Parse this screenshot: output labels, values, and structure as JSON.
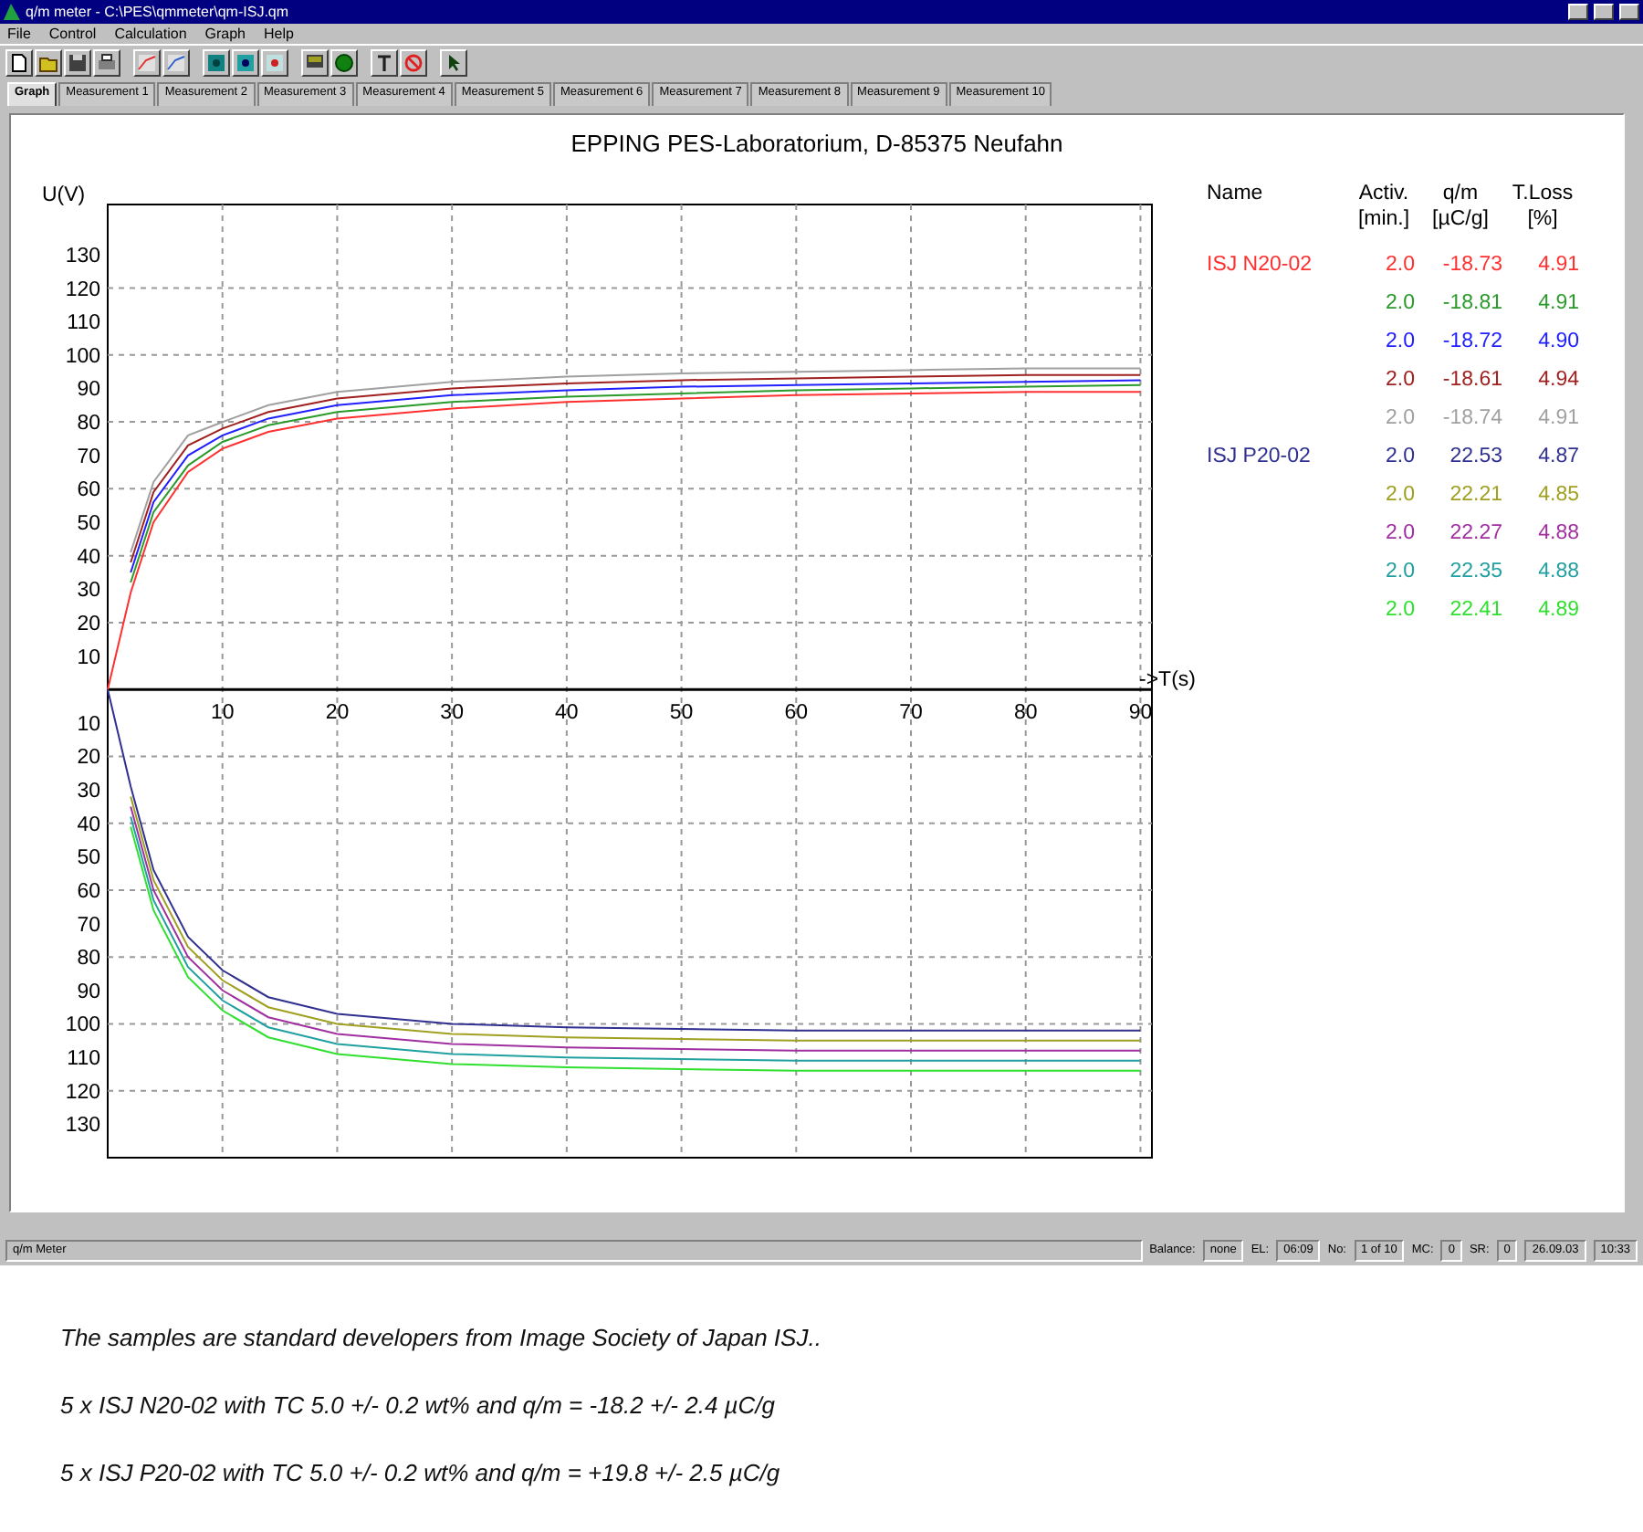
{
  "window": {
    "title": "q/m meter - C:\\PES\\qmmeter\\qm-ISJ.qm"
  },
  "menu": [
    "File",
    "Control",
    "Calculation",
    "Graph",
    "Help"
  ],
  "tabs": [
    {
      "label": "Graph",
      "selected": true
    },
    {
      "label": "Measurement 1",
      "selected": false
    },
    {
      "label": "Measurement 2",
      "selected": false
    },
    {
      "label": "Measurement 3",
      "selected": false
    },
    {
      "label": "Measurement 4",
      "selected": false
    },
    {
      "label": "Measurement 5",
      "selected": false
    },
    {
      "label": "Measurement 6",
      "selected": false
    },
    {
      "label": "Measurement 7",
      "selected": false
    },
    {
      "label": "Measurement 8",
      "selected": false
    },
    {
      "label": "Measurement 9",
      "selected": false
    },
    {
      "label": "Measurement 10",
      "selected": false
    }
  ],
  "graph": {
    "title": "EPPING PES-Laboratorium, D-85375 Neufahn",
    "chart_data": {
      "type": "line",
      "grid": true,
      "ylabel": "U(V)",
      "xlabel": "->T(s)",
      "x": [
        0,
        2,
        4,
        7,
        10,
        14,
        20,
        30,
        40,
        50,
        60,
        70,
        80,
        90
      ],
      "xlim": [
        0,
        91
      ],
      "ylim": [
        -140,
        145
      ],
      "xticks": [
        10,
        20,
        30,
        40,
        50,
        60,
        70,
        80,
        90
      ],
      "yticks": [
        {
          "value": -130,
          "label": "130"
        },
        {
          "value": -120,
          "label": "120"
        },
        {
          "value": -110,
          "label": "110"
        },
        {
          "value": -100,
          "label": "100"
        },
        {
          "value": -90,
          "label": "90"
        },
        {
          "value": -80,
          "label": "80"
        },
        {
          "value": -70,
          "label": "70"
        },
        {
          "value": -60,
          "label": "60"
        },
        {
          "value": -50,
          "label": "50"
        },
        {
          "value": -40,
          "label": "40"
        },
        {
          "value": -30,
          "label": "30"
        },
        {
          "value": -20,
          "label": "20"
        },
        {
          "value": -10,
          "label": "10"
        },
        10,
        20,
        30,
        40,
        50,
        60,
        70,
        80,
        90,
        100,
        110,
        120,
        130
      ],
      "series": [
        {
          "color": "#ff3030",
          "values": [
            0,
            29,
            50,
            65,
            72,
            77,
            81,
            84,
            86,
            87,
            88,
            88.5,
            89,
            89
          ]
        },
        {
          "color": "#2a9a2a",
          "values": [
            null,
            32,
            53,
            67,
            74,
            79,
            83,
            86,
            87.5,
            88.5,
            89.5,
            90,
            90.5,
            91
          ]
        },
        {
          "color": "#2020ff",
          "values": [
            null,
            35,
            56,
            70,
            76,
            81,
            85,
            88,
            89.5,
            90.5,
            91,
            91.5,
            92,
            92.5
          ]
        },
        {
          "color": "#a02020",
          "values": [
            null,
            38,
            59,
            73,
            78,
            83,
            87,
            90,
            91.5,
            92.5,
            93,
            93.5,
            94,
            94
          ]
        },
        {
          "color": "#a0a0a0",
          "values": [
            null,
            41,
            62,
            76,
            80,
            85,
            89,
            92,
            93.5,
            94.5,
            95,
            95.5,
            96,
            96
          ]
        },
        {
          "color": "#303090",
          "values": [
            0,
            -29,
            -54,
            -74,
            -84,
            -92,
            -97,
            -100,
            -101,
            -101.5,
            -102,
            -102,
            -102,
            -102
          ]
        },
        {
          "color": "#a0a020",
          "values": [
            null,
            -32,
            -57,
            -77,
            -87,
            -95,
            -100,
            -103,
            -104,
            -104.5,
            -105,
            -105,
            -105,
            -105
          ]
        },
        {
          "color": "#a030a0",
          "values": [
            null,
            -35,
            -60,
            -80,
            -90,
            -98,
            -103,
            -106,
            -107,
            -107.5,
            -108,
            -108,
            -108,
            -108
          ]
        },
        {
          "color": "#20a0a0",
          "values": [
            null,
            -38,
            -63,
            -83,
            -93,
            -101,
            -106,
            -109,
            -110,
            -110.5,
            -111,
            -111,
            -111,
            -111
          ]
        },
        {
          "color": "#30e030",
          "values": [
            null,
            -41,
            -66,
            -86,
            -96,
            -104,
            -109,
            -112,
            -113,
            -113.5,
            -114,
            -114,
            -114,
            -114
          ]
        }
      ]
    }
  },
  "table": {
    "columns": [
      {
        "label": "Name"
      },
      {
        "label": "Activ.",
        "unit": "[min.]"
      },
      {
        "label": "q/m",
        "unit": "[µC/g]"
      },
      {
        "label": "T.Loss",
        "unit": "[%]"
      }
    ],
    "rows": [
      {
        "name": "ISJ N20-02",
        "activ": "2.0",
        "qm": "-18.73",
        "tloss": "4.91",
        "color": "#ff3030"
      },
      {
        "activ": "2.0",
        "qm": "-18.81",
        "tloss": "4.91",
        "color": "#2a9a2a"
      },
      {
        "activ": "2.0",
        "qm": "-18.72",
        "tloss": "4.90",
        "color": "#2020ff"
      },
      {
        "activ": "2.0",
        "qm": "-18.61",
        "tloss": "4.94",
        "color": "#a02020"
      },
      {
        "activ": "2.0",
        "qm": "-18.74",
        "tloss": "4.91",
        "color": "#a0a0a0"
      },
      {
        "name": "ISJ P20-02",
        "activ": "2.0",
        "qm": "22.53",
        "tloss": "4.87",
        "color": "#303090"
      },
      {
        "activ": "2.0",
        "qm": "22.21",
        "tloss": "4.85",
        "color": "#a0a020"
      },
      {
        "activ": "2.0",
        "qm": "22.27",
        "tloss": "4.88",
        "color": "#a030a0"
      },
      {
        "activ": "2.0",
        "qm": "22.35",
        "tloss": "4.88",
        "color": "#20a0a0"
      },
      {
        "activ": "2.0",
        "qm": "22.41",
        "tloss": "4.89",
        "color": "#30e030"
      }
    ]
  },
  "status_bar": {
    "app": "q/m Meter",
    "fields": [
      {
        "label": "Balance:",
        "value": "none"
      },
      {
        "label": "EL:",
        "value": "06:09"
      },
      {
        "label": "No:",
        "value": "1 of 10"
      },
      {
        "label": "MC:",
        "value": "0"
      },
      {
        "label": "SR:",
        "value": "0"
      },
      {
        "value": "26.09.03"
      },
      {
        "value": "10:33"
      }
    ]
  },
  "notes": [
    "The samples are standard developers  from Image Society of Japan ISJ..",
    "5 x ISJ N20-02 with TC 5.0 +/- 0.2 wt% and q/m =  -18.2 +/- 2.4 µC/g",
    "5 x ISJ P20-02 with TC 5.0 +/- 0.2 wt% and q/m =  +19.8 +/- 2.5 µC/g"
  ]
}
